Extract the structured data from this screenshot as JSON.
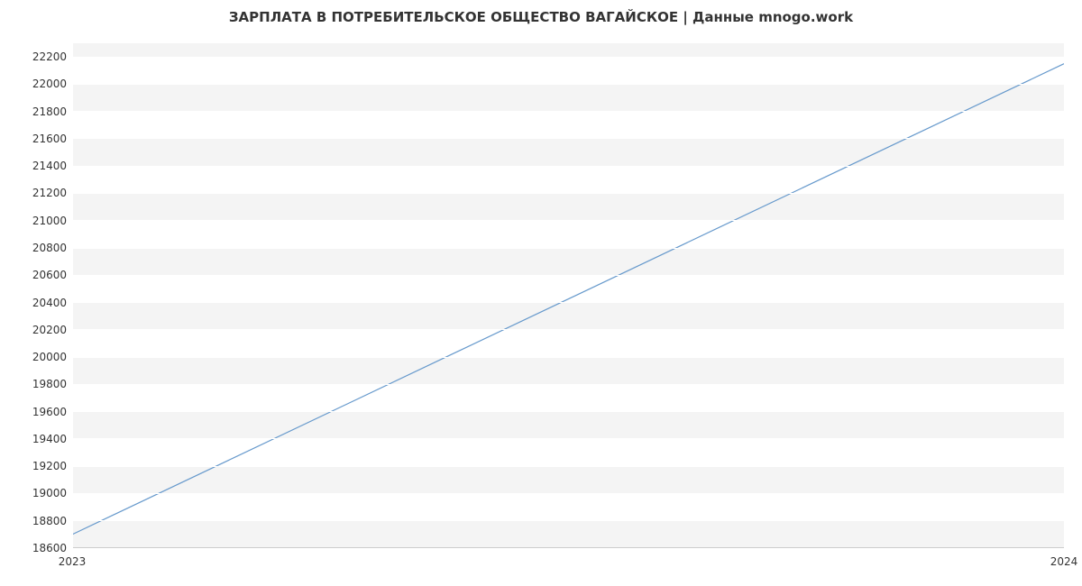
{
  "chart_data": {
    "type": "line",
    "title": "ЗАРПЛАТА В ПОТРЕБИТЕЛЬСКОЕ ОБЩЕСТВО ВАГАЙСКОЕ | Данные mnogo.work",
    "xlabel": "",
    "ylabel": "",
    "x_ticks": [
      "2023",
      "2024"
    ],
    "y_ticks": [
      18600,
      18800,
      19000,
      19200,
      19400,
      19600,
      19800,
      20000,
      20200,
      20400,
      20600,
      20800,
      21000,
      21200,
      21400,
      21600,
      21800,
      22000,
      22200
    ],
    "ylim": [
      18600,
      22300
    ],
    "x": [
      "2023",
      "2024"
    ],
    "values": [
      18700,
      22150
    ],
    "line_color": "#6699cc"
  }
}
